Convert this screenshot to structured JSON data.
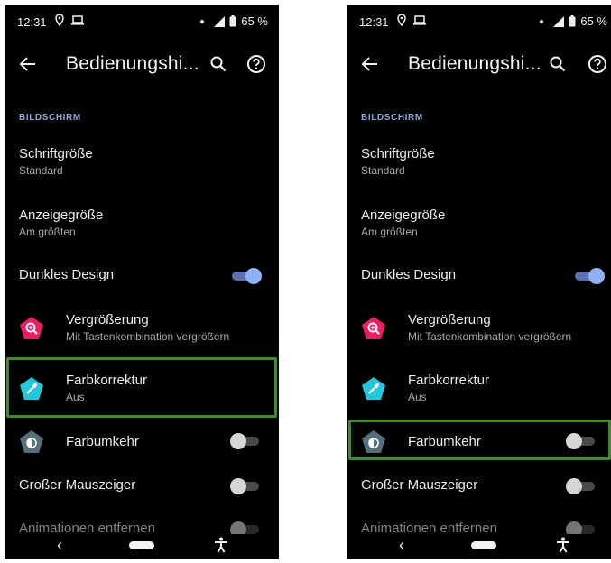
{
  "phones": [
    {
      "status": {
        "time": "12:31",
        "battery": "65 %"
      },
      "app_bar": {
        "title": "Bedienungshi..."
      },
      "section": "BILDSCHIRM",
      "rows": [
        {
          "title": "Schriftgröße",
          "subtitle": "Standard"
        },
        {
          "title": "Anzeigegröße",
          "subtitle": "Am größten"
        },
        {
          "title": "Dunkles Design"
        },
        {
          "title": "Vergrößerung",
          "subtitle": "Mit Tastenkombination vergrößern"
        },
        {
          "title": "Farbkorrektur",
          "subtitle": "Aus"
        },
        {
          "title": "Farbumkehr"
        },
        {
          "title": "Großer Mauszeiger"
        },
        {
          "title": "Animationen entfernen"
        }
      ],
      "highlighted_row": "Farbkorrektur"
    },
    {
      "status": {
        "time": "12:31",
        "battery": "65 %"
      },
      "app_bar": {
        "title": "Bedienungshi..."
      },
      "section": "BILDSCHIRM",
      "rows": [
        {
          "title": "Schriftgröße",
          "subtitle": "Standard"
        },
        {
          "title": "Anzeigegröße",
          "subtitle": "Am größten"
        },
        {
          "title": "Dunkles Design"
        },
        {
          "title": "Vergrößerung",
          "subtitle": "Mit Tastenkombination vergrößern"
        },
        {
          "title": "Farbkorrektur",
          "subtitle": "Aus"
        },
        {
          "title": "Farbumkehr"
        },
        {
          "title": "Großer Mauszeiger"
        },
        {
          "title": "Animationen entfernen"
        }
      ],
      "highlighted_row": "Farbumkehr"
    }
  ],
  "toggles": {
    "dunkles_design": "on",
    "farbumkehr": "off",
    "grosser_mauszeiger": "off",
    "animationen_entfernen": "off"
  },
  "icons": {
    "vergroesserung": "magnify-icon",
    "farbkorrektur": "color-dropper-icon",
    "farbumkehr": "invert-colors-icon"
  },
  "colors": {
    "background": "#000000",
    "accent_toggle_on": "#8fb1f5",
    "section_label": "#8fa7d6",
    "highlight_border": "#3f8a2a",
    "magnify_icon": "#e91e63",
    "color_correction_icon": "#26c6da",
    "invert_icon": "#546e7a"
  }
}
